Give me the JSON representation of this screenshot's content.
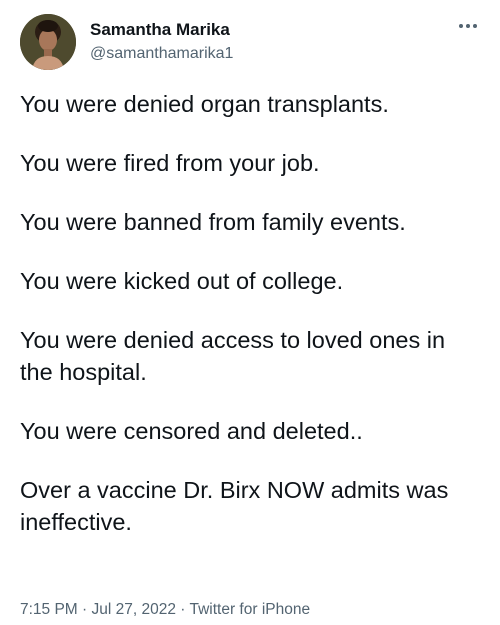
{
  "author": {
    "display_name": "Samantha Marika",
    "handle": "@samanthamarika1"
  },
  "icons": {
    "avatar": "profile-photo",
    "more": "more-horizontal-icon"
  },
  "tweet": {
    "paragraphs": [
      "You were denied organ transplants.",
      "You were fired from your job.",
      "You were banned from family events.",
      "You were kicked out of college.",
      "You were denied access to loved ones in the hospital.",
      "You were censored and deleted..",
      "Over a vaccine Dr. Birx NOW admits was ineffective."
    ],
    "time": "7:15 PM",
    "separator": " · ",
    "date": "Jul 27, 2022",
    "source": "Twitter for iPhone"
  },
  "colors": {
    "text": "#0f1419",
    "secondary": "#536471",
    "background": "#ffffff"
  }
}
